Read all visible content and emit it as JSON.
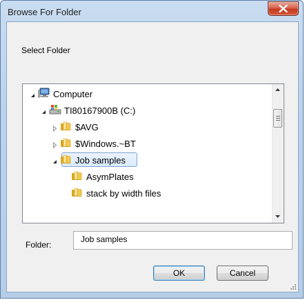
{
  "window": {
    "title": "Browse For Folder"
  },
  "description": "Select Folder",
  "tree": [
    {
      "label": "Computer",
      "icon": "computer-icon",
      "expander": "expanded",
      "selected": false
    },
    {
      "label": "TI80167900B (C:)",
      "icon": "drive-icon",
      "expander": "expanded",
      "selected": false
    },
    {
      "label": "$AVG",
      "icon": "folder-icon",
      "expander": "collapsed",
      "selected": false
    },
    {
      "label": "$Windows.~BT",
      "icon": "folder-icon",
      "expander": "collapsed",
      "selected": false
    },
    {
      "label": "Job samples",
      "icon": "folder-icon",
      "expander": "expanded",
      "selected": true
    },
    {
      "label": "AsymPlates",
      "icon": "folder-icon",
      "expander": "none",
      "selected": false
    },
    {
      "label": "stack by width files",
      "icon": "folder-icon",
      "expander": "none",
      "selected": false
    }
  ],
  "folder": {
    "label": "Folder:",
    "value": "Job samples"
  },
  "buttons": {
    "ok": "OK",
    "cancel": "Cancel"
  },
  "colors": {
    "titlebar": "#bad2ec",
    "close_button": "#c2391f",
    "selection_fill": "#d9ebfc",
    "selection_border": "#7da2ce",
    "folder_yellow": "#f2c94c"
  }
}
